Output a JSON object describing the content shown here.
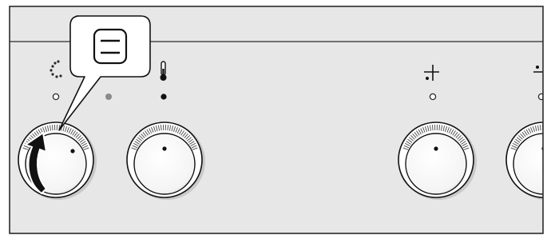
{
  "colors": {
    "panel_bg": "#e7e7e7",
    "frame": "#2b2b2b",
    "knob_fill": "#ffffff",
    "grip": "#555555",
    "lamp_off": "#ffffff",
    "lamp_gray": "#8a8a8a",
    "arrow": "#111111",
    "callout_bg": "#ffffff"
  },
  "callout": {
    "icon": "oven-top-bottom-heat-icon"
  },
  "knobs": [
    {
      "id": "oven-function-knob",
      "symbol_icon": "oven-light-dotted-icon",
      "indicator": "lamp-off",
      "rotation_arrow": true
    },
    {
      "id": "temperature-knob",
      "symbol_icon": "thermometer-icon",
      "indicator": "lamp-black"
    },
    {
      "id": "hob-zone-knob-1",
      "symbol_icon": "hob-zone-plus-icon",
      "indicator": "lamp-off"
    },
    {
      "id": "hob-zone-knob-2",
      "symbol_icon": "hob-zone-icon",
      "indicator": "lamp-off",
      "partially_visible": true
    }
  ],
  "extra_indicator": {
    "icon": "indicator-light-gray-icon"
  }
}
